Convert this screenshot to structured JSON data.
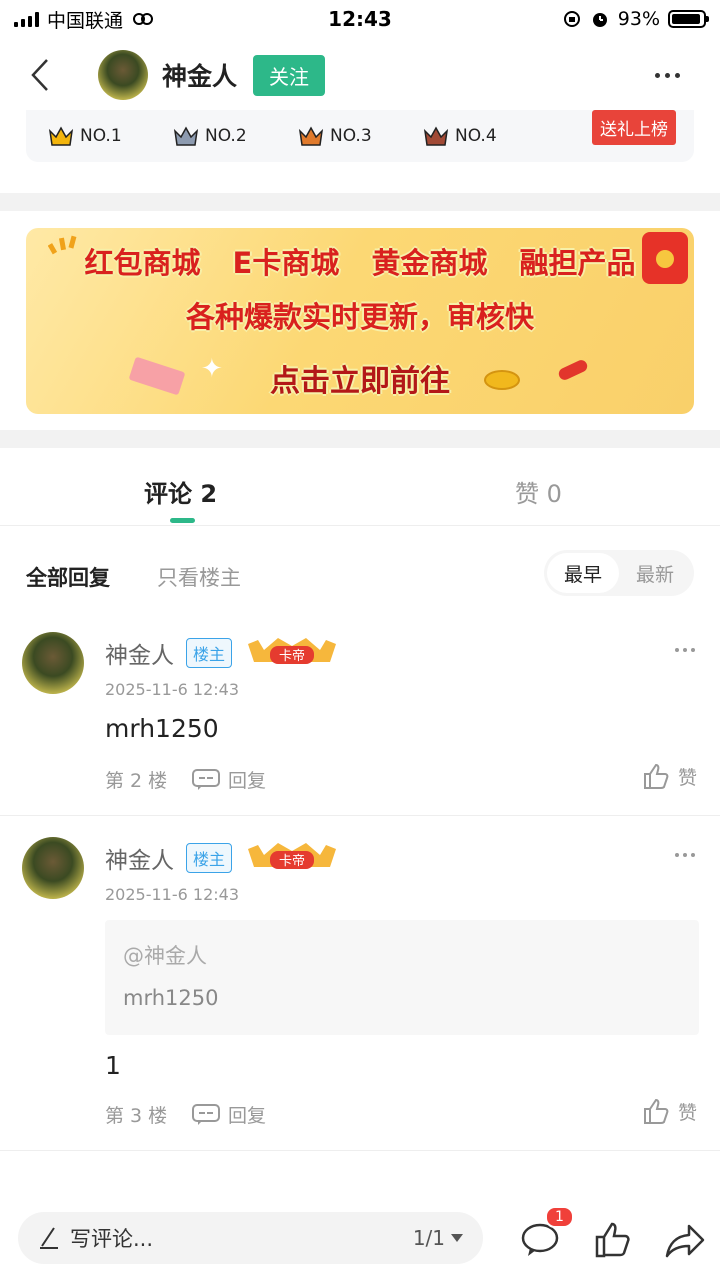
{
  "status_bar": {
    "carrier": "中国联通",
    "time": "12:43",
    "battery": "93%",
    "battery_level": 0.93
  },
  "header": {
    "author_name": "神金人",
    "follow_label": "关注"
  },
  "ranking": {
    "items": [
      "NO.1",
      "NO.2",
      "NO.3",
      "NO.4"
    ],
    "gift_button": "送礼上榜",
    "crown_colors": [
      "#f3b50d",
      "#8d9bb0",
      "#e07a2c",
      "#a14a36"
    ]
  },
  "banner": {
    "line1": "红包商城 E卡商城 黄金商城 融担产品",
    "line2": "各种爆款实时更新，审核快",
    "cta": "点击立即前往"
  },
  "tabs": {
    "comments": "评论 2",
    "likes": "赞 0"
  },
  "filter": {
    "all": "全部回复",
    "op_only": "只看楼主",
    "sort_earliest": "最早",
    "sort_latest": "最新"
  },
  "comments": [
    {
      "name": "神金人",
      "badge": "楼主",
      "level": "卡帝",
      "time": "2025-11-6 12:43",
      "text": "mrh1250",
      "floor": "第 2 楼",
      "reply": "回复",
      "like": "赞"
    },
    {
      "name": "神金人",
      "badge": "楼主",
      "level": "卡帝",
      "time": "2025-11-6 12:43",
      "quote_who": "@神金人",
      "quote_text": "mrh1250",
      "text": "1",
      "floor": "第 3 楼",
      "reply": "回复",
      "like": "赞"
    }
  ],
  "bottom_bar": {
    "placeholder": "写评论...",
    "page": "1/1",
    "notification_count": "1"
  },
  "colors": {
    "accent": "#2db889",
    "gift_red": "#e8443a",
    "owner_badge": "#3ba3e8"
  }
}
